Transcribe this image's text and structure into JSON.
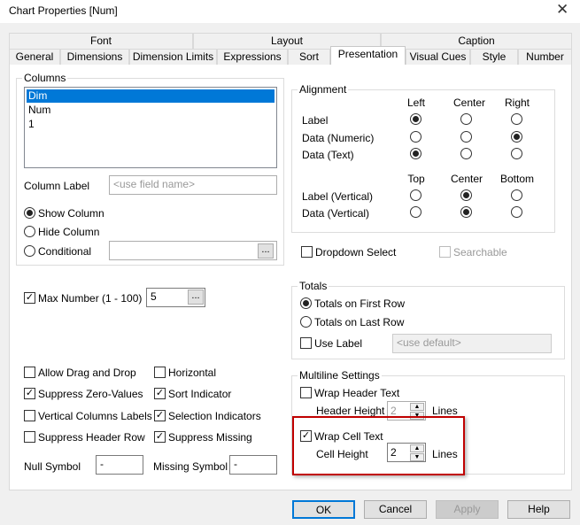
{
  "window": {
    "title": "Chart Properties [Num]"
  },
  "tabs_row1": [
    "Font",
    "Layout",
    "Caption"
  ],
  "tabs_row2": [
    "General",
    "Dimensions",
    "Dimension Limits",
    "Expressions",
    "Sort",
    "Presentation",
    "Visual Cues",
    "Style",
    "Number"
  ],
  "active_tab": "Presentation",
  "columns": {
    "title": "Columns",
    "items": [
      "Dim",
      "Num",
      "1"
    ],
    "selected": "Dim",
    "column_label": "Column Label",
    "column_label_placeholder": "<use field name>",
    "show_column": "Show Column",
    "hide_column": "Hide Column",
    "conditional": "Conditional",
    "visibility": "Show Column",
    "dots": "..."
  },
  "alignment": {
    "title": "Alignment",
    "h_headers": [
      "Left",
      "Center",
      "Right"
    ],
    "rows": [
      {
        "label": "Label",
        "value": "Left"
      },
      {
        "label": "Data (Numeric)",
        "value": "Right"
      },
      {
        "label": "Data (Text)",
        "value": "Left"
      }
    ],
    "v_headers": [
      "Top",
      "Center",
      "Bottom"
    ],
    "vrows": [
      {
        "label": "Label (Vertical)",
        "value": "Center"
      },
      {
        "label": "Data (Vertical)",
        "value": "Center"
      }
    ]
  },
  "dropdown_select": {
    "label": "Dropdown Select",
    "checked": false
  },
  "searchable": {
    "label": "Searchable",
    "checked": false,
    "disabled": true
  },
  "max_number": {
    "label": "Max Number (1 - 100)",
    "checked": true,
    "value": "5"
  },
  "totals": {
    "title": "Totals",
    "first": "Totals on First Row",
    "last": "Totals on Last Row",
    "selected": "first",
    "use_label": "Use Label",
    "use_label_checked": false,
    "placeholder": "<use default>"
  },
  "options": [
    {
      "label": "Allow Drag and Drop",
      "checked": false
    },
    {
      "label": "Horizontal",
      "checked": false
    },
    {
      "label": "Suppress Zero-Values",
      "checked": true
    },
    {
      "label": "Sort Indicator",
      "checked": true
    },
    {
      "label": "Vertical Columns Labels",
      "checked": false
    },
    {
      "label": "Selection Indicators",
      "checked": true
    },
    {
      "label": "Suppress Header Row",
      "checked": false
    },
    {
      "label": "Suppress Missing",
      "checked": true
    }
  ],
  "null_symbol": {
    "label": "Null Symbol",
    "value": "-"
  },
  "missing_symbol": {
    "label": "Missing Symbol",
    "value": "-"
  },
  "multiline": {
    "title": "Multiline Settings",
    "wrap_header": "Wrap Header Text",
    "wrap_header_checked": false,
    "header_height": "Header Height",
    "header_value": "2",
    "wrap_cell": "Wrap Cell Text",
    "wrap_cell_checked": true,
    "cell_height": "Cell Height",
    "cell_value": "2",
    "lines": "Lines"
  },
  "highlight_color": "#c00000",
  "buttons": {
    "ok": "OK",
    "cancel": "Cancel",
    "apply": "Apply",
    "help": "Help"
  }
}
